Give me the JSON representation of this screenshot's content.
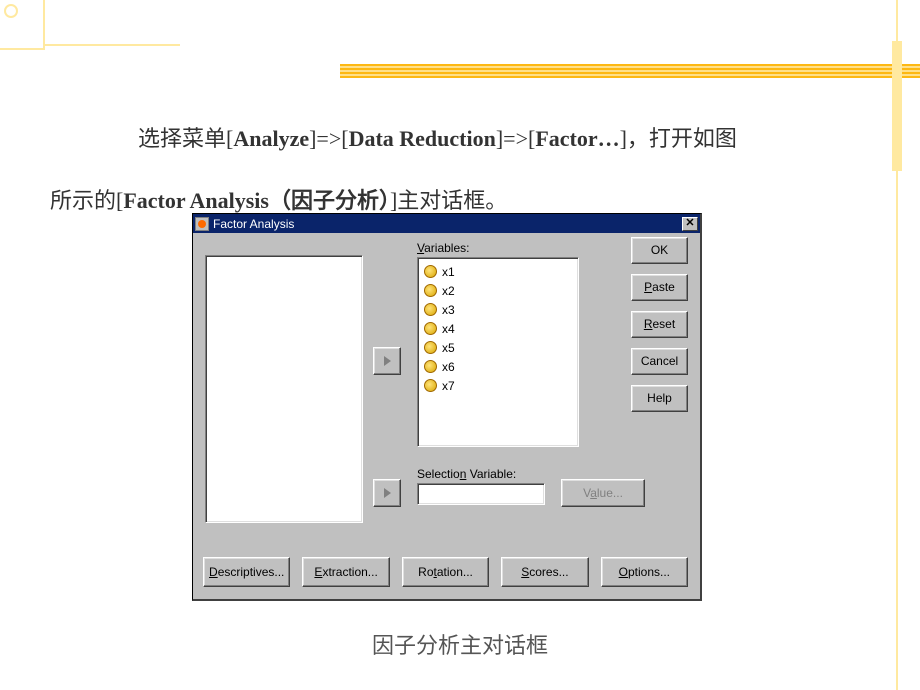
{
  "text": {
    "line1_prefix": "选择菜单[",
    "line1_a": "Analyze",
    "line1_mid1": "]=>[",
    "line1_b": "Data Reduction",
    "line1_mid2": "]=>[",
    "line1_c": "Factor…",
    "line1_suffix": "]，打开如图",
    "line2_prefix": "所示的[",
    "line2_a": "Factor Analysis（因子分析）",
    "line2_suffix": "]主对话框。",
    "caption": "因子分析主对话框"
  },
  "dialog": {
    "title": "Factor Analysis",
    "close_x": "✕",
    "variables_label": "Variables:",
    "variables": [
      "x1",
      "x2",
      "x3",
      "x4",
      "x5",
      "x6",
      "x7"
    ],
    "selection_label": "Selection Variable:",
    "selection_value": "",
    "value_btn": "Value...",
    "buttons": {
      "ok": "OK",
      "paste": "Paste",
      "reset": "Reset",
      "cancel": "Cancel",
      "help": "Help"
    },
    "bottom": {
      "descriptives": "Descriptives...",
      "extraction": "Extraction...",
      "rotation": "Rotation...",
      "scores": "Scores...",
      "options": "Options..."
    }
  }
}
